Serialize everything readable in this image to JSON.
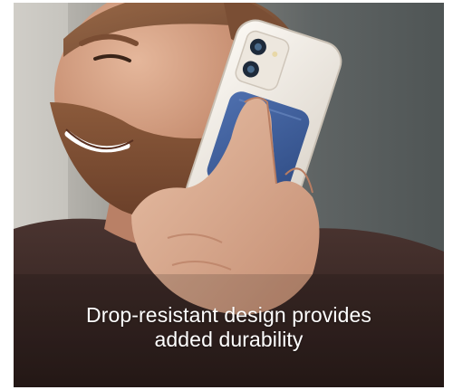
{
  "image": {
    "subject_description_icon": "man-on-phone-photo"
  },
  "caption": {
    "line1": "Drop-resistant design provides",
    "line2": "added durability"
  },
  "colors": {
    "caption_text": "#ffffff",
    "phone_case": "#f2ece4",
    "wallet": "#3b5a93",
    "shirt": "#3b2a26",
    "background": "#6b7070"
  }
}
